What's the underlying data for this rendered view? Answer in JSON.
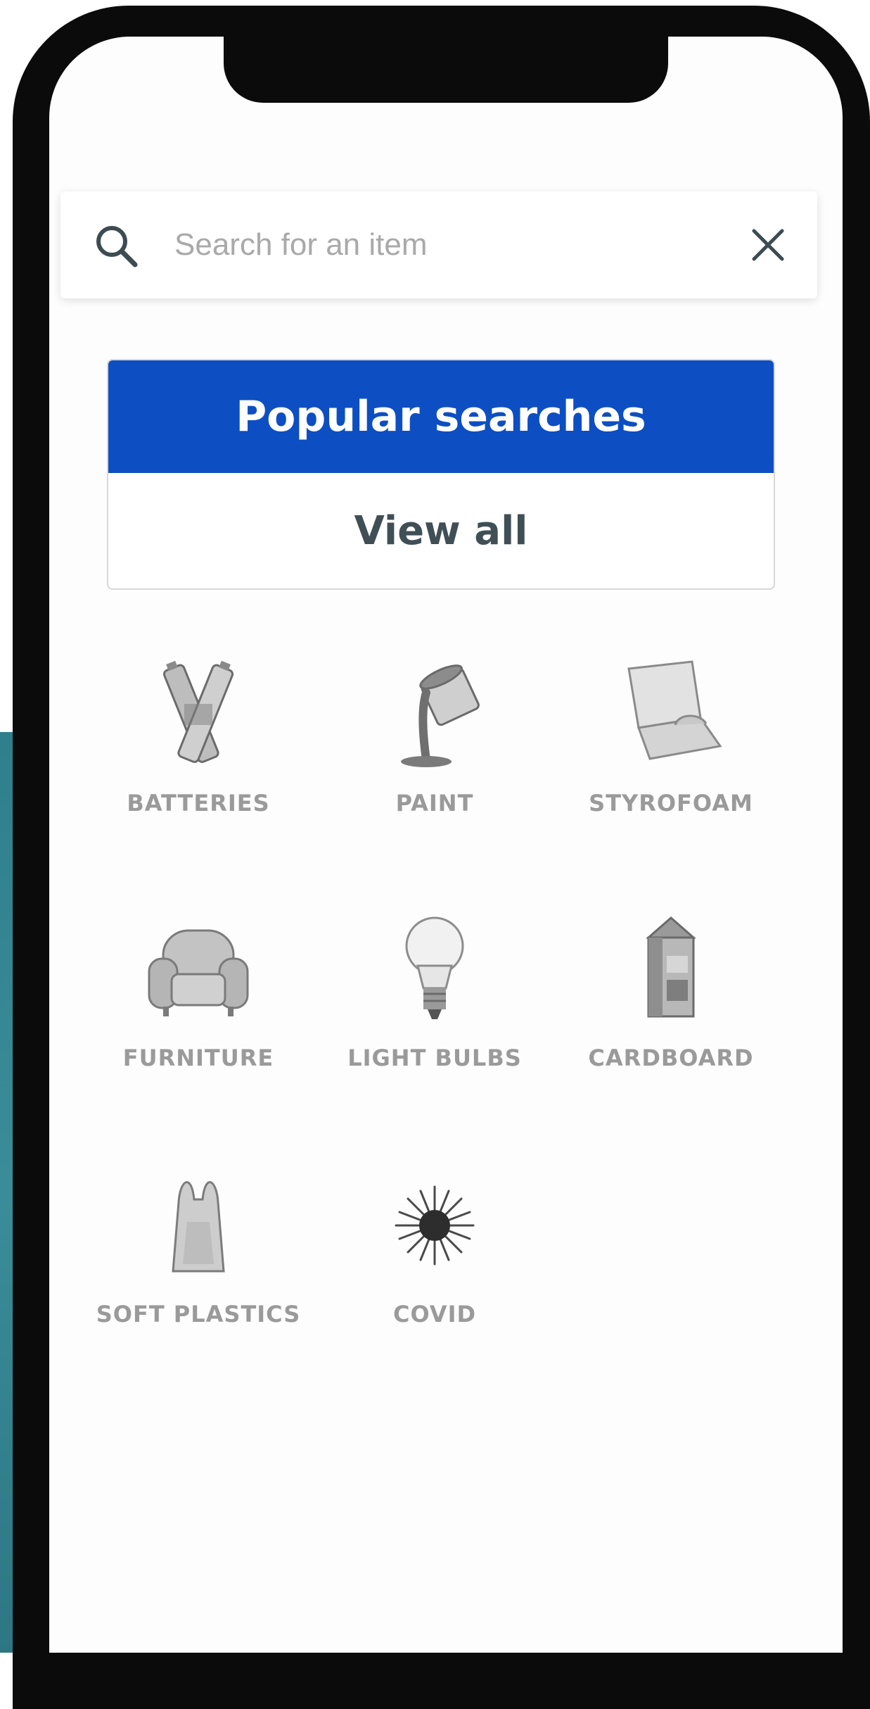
{
  "search": {
    "placeholder": "Search for an item"
  },
  "popular": {
    "title": "Popular searches",
    "view_all": "View all"
  },
  "categories": [
    {
      "label": "BATTERIES",
      "icon": "batteries-icon"
    },
    {
      "label": "PAINT",
      "icon": "paint-icon"
    },
    {
      "label": "STYROFOAM",
      "icon": "styrofoam-icon"
    },
    {
      "label": "FURNITURE",
      "icon": "furniture-icon"
    },
    {
      "label": "LIGHT BULBS",
      "icon": "light-bulb-icon"
    },
    {
      "label": "CARDBOARD",
      "icon": "cardboard-icon"
    },
    {
      "label": "SOFT PLASTICS",
      "icon": "soft-plastics-icon"
    },
    {
      "label": "COVID",
      "icon": "covid-icon"
    }
  ],
  "colors": {
    "accent": "#0d4fc2",
    "label": "#9a9a9a",
    "frame": "#0b0b0b",
    "teal": "#2f7f8c"
  }
}
